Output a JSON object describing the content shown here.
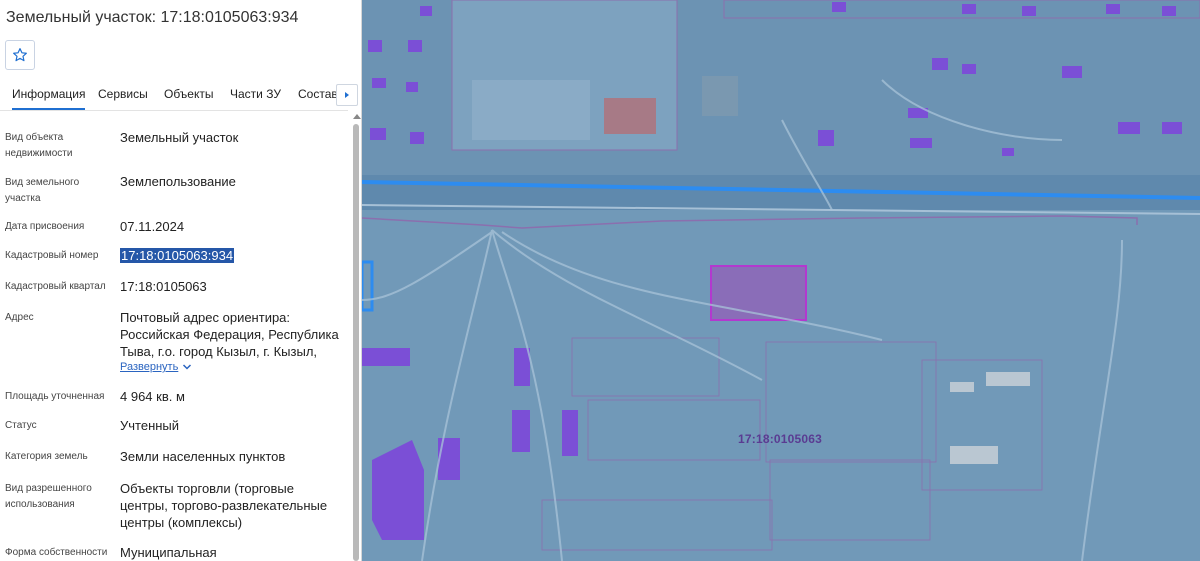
{
  "header": {
    "title": "Земельный участок: 17:18:0105063:934"
  },
  "tabs": [
    {
      "label": "Информация",
      "active": true
    },
    {
      "label": "Сервисы"
    },
    {
      "label": "Объекты"
    },
    {
      "label": "Части ЗУ"
    },
    {
      "label": "Состав"
    }
  ],
  "icons": {
    "favorite": "star-icon",
    "tabs_next": "chevron-right-icon",
    "expand": "chevron-down-icon"
  },
  "fields": {
    "object_type": {
      "label": "Вид объекта недвижимости",
      "value": "Земельный участок"
    },
    "land_type": {
      "label": "Вид земельного участка",
      "value": "Землепользование"
    },
    "assign_date": {
      "label": "Дата присвоения",
      "value": "07.11.2024"
    },
    "cadastral_number": {
      "label": "Кадастровый номер",
      "value": "17:18:0105063:934"
    },
    "cadastral_quarter": {
      "label": "Кадастровый квартал",
      "value": "17:18:0105063"
    },
    "address": {
      "label": "Адрес",
      "value": "Почтовый адрес ориентира: Российская Федерация, Республика Тыва, г.о. город Кызыл, г. Кызыл,",
      "expand": "Развернуть"
    },
    "area": {
      "label": "Площадь уточненная",
      "value": "4 964 кв. м"
    },
    "status": {
      "label": "Статус",
      "value": "Учтенный"
    },
    "land_category": {
      "label": "Категория земель",
      "value": "Земли населенных пунктов"
    },
    "permitted_use": {
      "label": "Вид разрешенного использования",
      "value": "Объекты торговли (торговые центры, торгово-развлекательные центры (комплексы)"
    },
    "ownership": {
      "label": "Форма собственности",
      "value": "Муниципальная"
    }
  },
  "map": {
    "quarter_label": "17:18:0105063",
    "colors": {
      "base": "#5f89ad",
      "highlight": "#8a3fb0",
      "road": "#2d8cf0",
      "building": "#7b4fd6"
    }
  }
}
